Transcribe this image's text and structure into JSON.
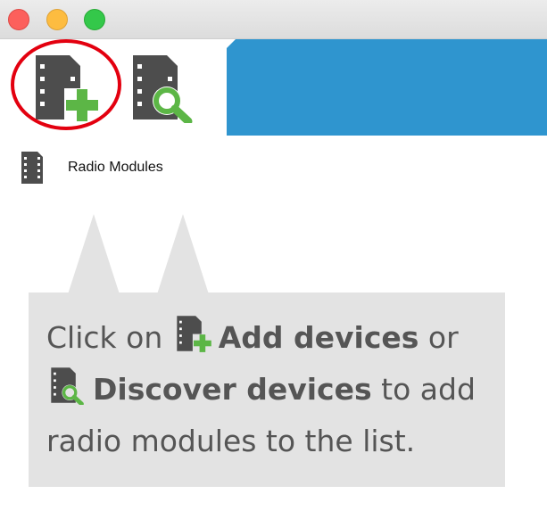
{
  "window": {
    "controls": [
      "close",
      "minimize",
      "maximize"
    ]
  },
  "toolbar": {
    "add_devices_icon": "add-device-icon",
    "discover_devices_icon": "discover-device-icon",
    "highlight_color": "#e3000f",
    "accent_color": "#2f95cf"
  },
  "list": {
    "items": [
      {
        "label": "Radio Modules",
        "icon": "radio-module-icon"
      }
    ]
  },
  "hint": {
    "part1": "Click on",
    "add_label": "Add devices",
    "part2": "or",
    "discover_label": "Discover devices",
    "part3": "to add radio modules to the list."
  },
  "colors": {
    "module_gray": "#4d4d4d",
    "plus_green": "#5cb646",
    "hint_bg": "#e3e3e3"
  }
}
